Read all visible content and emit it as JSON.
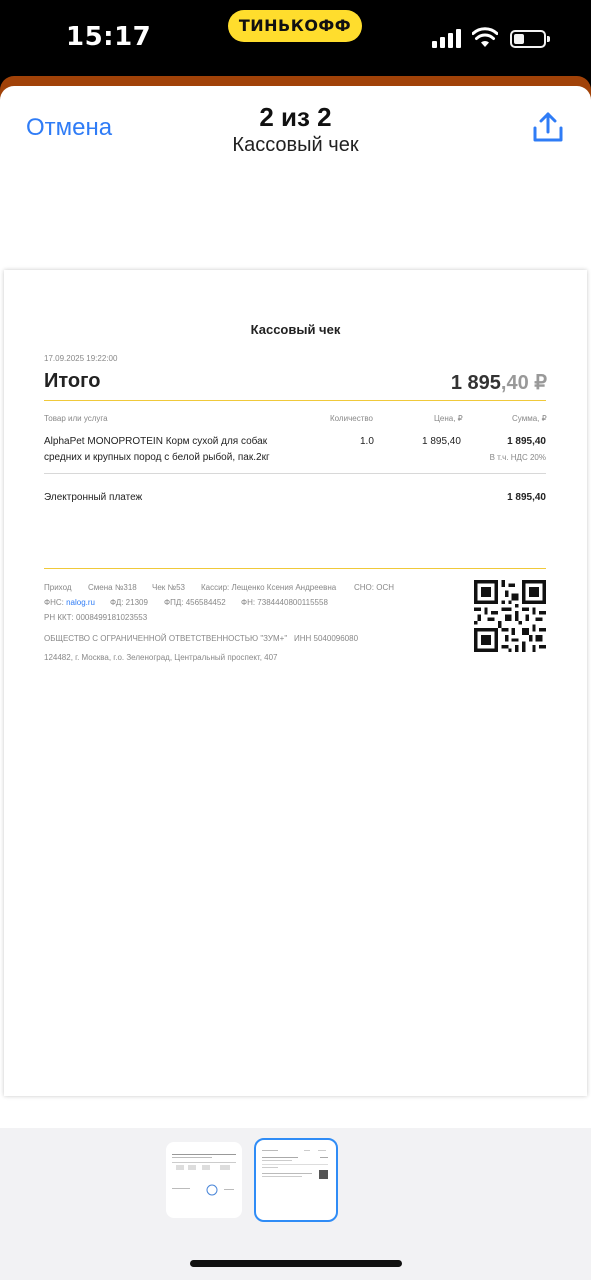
{
  "status_bar": {
    "time": "15:17",
    "bank_badge": "ТИНЬКОФФ"
  },
  "header": {
    "cancel_label": "Отмена",
    "page_counter": "2 из 2",
    "subtitle": "Кассовый чек"
  },
  "receipt": {
    "title": "Кассовый чек",
    "datetime": "17.09.2025  19:22:00",
    "total_label": "Итого",
    "total_int": "1 895",
    "total_dec": ",40 ₽",
    "columns": {
      "item": "Товар или услуга",
      "qty": "Количество",
      "price": "Цена, ₽",
      "sum": "Сумма, ₽"
    },
    "items": [
      {
        "name_line1": "AlphaPet MONOPROTEIN Корм сухой для собак",
        "name_line2": "средних и крупных пород с белой рыбой, пак.2кг",
        "qty": "1.0",
        "price": "1 895,40",
        "sum": "1 895,40",
        "vat": "В т.ч. НДС 20%"
      }
    ],
    "payment_label": "Электронный платеж",
    "payment_value": "1 895,40",
    "footer": {
      "type": "Приход",
      "shift": "Смена №318",
      "check": "Чек №53",
      "cashier": "Кассир: Лещенко Ксения Андреевна",
      "sno": "СНО: ОСН",
      "fns_label": "ФНС:",
      "fns_link": "nalog.ru",
      "fd": "ФД: 21309",
      "fpd": "ФПД: 456584452",
      "fn": "ФН: 7384440800115558",
      "rn_kkt": "РН ККТ: 0008499181023553",
      "company": "ОБЩЕСТВО С ОГРАНИЧЕННОЙ ОТВЕТСТВЕННОСТЬЮ \"ЗУМ+\"",
      "inn": "ИНН 5040096080",
      "address": "124482, г. Москва, г.о. Зеленоград, Центральный проспект, 407"
    }
  },
  "thumbnails": {
    "count": 2,
    "selected": 2
  },
  "colors": {
    "accent_blue": "#2f7cf6",
    "bank_yellow": "#ffdd2d",
    "sheet_orange": "#a14208",
    "divider_yellow": "#f0c93a"
  },
  "icons": [
    "cellular-signal-icon",
    "wifi-icon",
    "battery-icon",
    "share-icon",
    "qr-code-icon"
  ]
}
